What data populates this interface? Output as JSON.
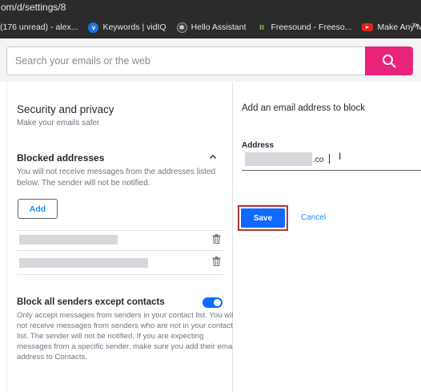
{
  "browser": {
    "url": "om/d/settings/8",
    "bookmarks": [
      {
        "label": "(176 unread) - alex...",
        "icon": "none"
      },
      {
        "label": "Keywords | vidIQ",
        "icon": "vidiq-icon"
      },
      {
        "label": "Hello Assistant",
        "icon": "chatgpt-icon"
      },
      {
        "label": "Freesound - Freeso...",
        "icon": "freesound-icon"
      },
      {
        "label": "Make Any Mic Sou...",
        "icon": "youtube-icon"
      }
    ],
    "more": "»"
  },
  "search": {
    "placeholder": "Search your emails or the web"
  },
  "settings": {
    "section_title": "Security and privacy",
    "section_subtitle": "Make your emails safer",
    "blocked": {
      "title": "Blocked addresses",
      "description": "You will not receive messages from the addresses listed below. The sender will not be notified.",
      "add_label": "Add"
    },
    "block_all": {
      "title": "Block all senders except contacts",
      "enabled": true,
      "description": "Only accept messages from senders in your contact list. You will not receive messages from senders who are not in your contact list. The sender will not be notified. If you are expecting messages from a specific sender, make sure you add their email address to Contacts."
    }
  },
  "form": {
    "title": "Add an email address to block",
    "address_label": "Address",
    "address_visible_suffix": ".co",
    "save_label": "Save",
    "cancel_label": "Cancel"
  },
  "colors": {
    "search_button": "#e9237a",
    "primary": "#0f69ff",
    "link": "#188fff",
    "highlight_outline": "#a9393d"
  }
}
